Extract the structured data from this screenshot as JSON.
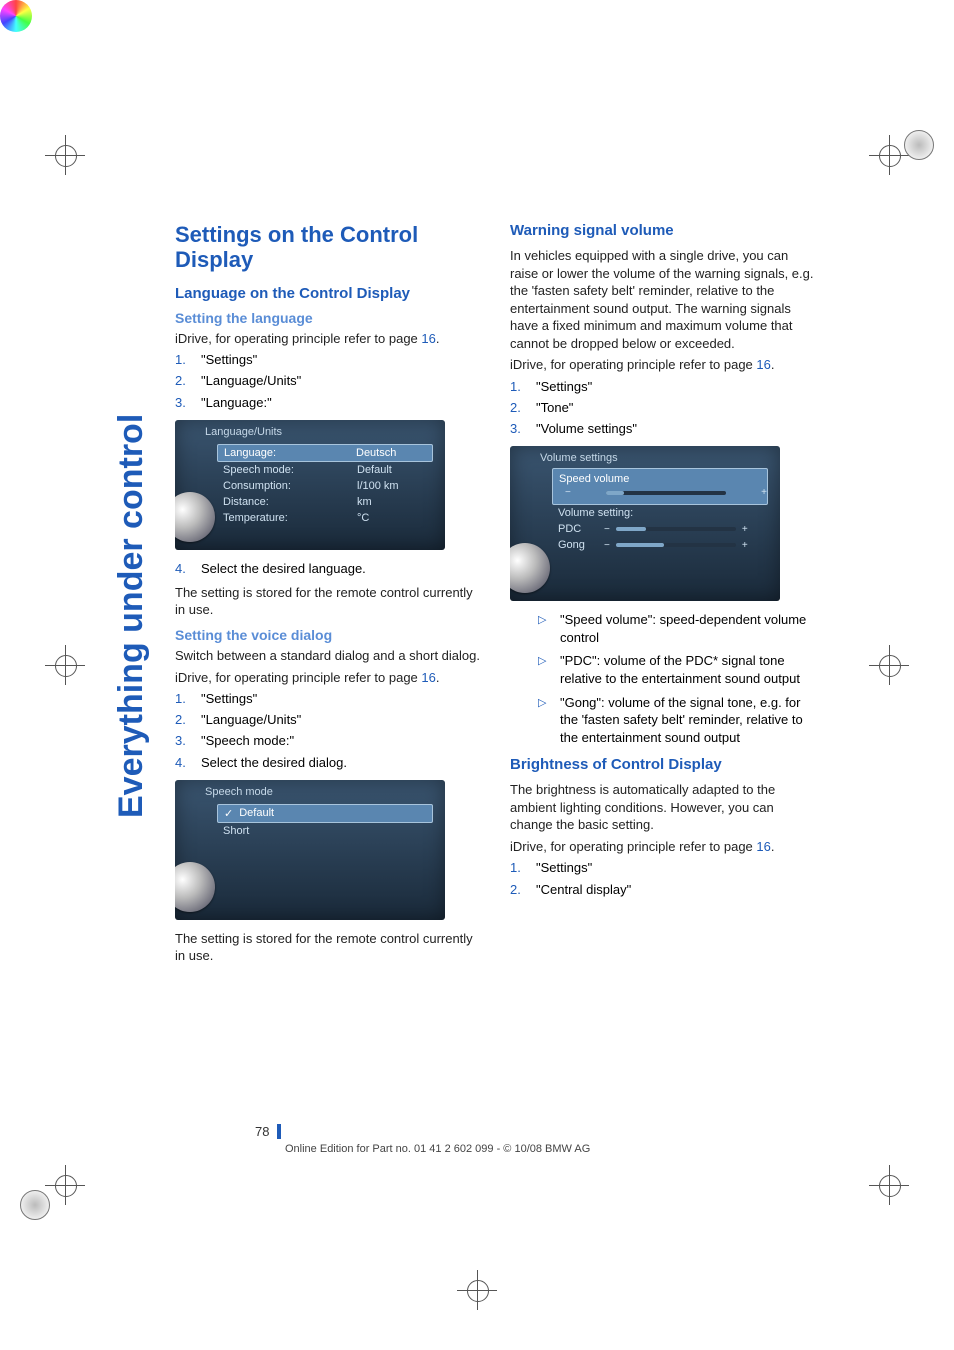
{
  "sidetab": "Everything under control",
  "page_number": "78",
  "footer_copy": "Online Edition for Part no. 01 41 2 602 099 - © 10/08 BMW AG",
  "page_ref": "16",
  "left": {
    "h1": "Settings on the Control Display",
    "h2a": "Language on the Control Display",
    "h3a": "Setting the language",
    "idrive_prefix": "iDrive, for operating principle refer to page ",
    "steps1": [
      "\"Settings\"",
      "\"Language/Units\"",
      "\"Language:\""
    ],
    "screenshot1": {
      "title": "Language/Units",
      "rows": [
        {
          "k": "Language:",
          "v": "Deutsch",
          "sel": true
        },
        {
          "k": "Speech mode:",
          "v": "Default"
        },
        {
          "k": "Consumption:",
          "v": "l/100 km"
        },
        {
          "k": "Distance:",
          "v": "km"
        },
        {
          "k": "Temperature:",
          "v": "°C"
        }
      ]
    },
    "step4": "Select the desired language.",
    "note1": "The setting is stored for the remote control currently in use.",
    "h3b": "Setting the voice dialog",
    "voice_intro": "Switch between a standard dialog and a short dialog.",
    "steps2": [
      "\"Settings\"",
      "\"Language/Units\"",
      "\"Speech mode:\"",
      "Select the desired dialog."
    ],
    "screenshot2": {
      "title": "Speech mode",
      "rows": [
        {
          "k": "Default",
          "sel": true,
          "check": true
        },
        {
          "k": "Short"
        }
      ]
    },
    "note2": "The setting is stored for the remote control currently in use."
  },
  "right": {
    "h2a": "Warning signal volume",
    "warn_body": "In vehicles equipped with a single drive, you can raise or lower the volume of the warning signals, e.g. the 'fasten safety belt' reminder, relative to the entertainment sound output. The warning signals have a fixed minimum and maximum volume that cannot be dropped below or exceeded.",
    "steps1": [
      "\"Settings\"",
      "\"Tone\"",
      "\"Volume settings\""
    ],
    "screenshot1": {
      "title": "Volume settings",
      "speed_label": "Speed volume",
      "section": "Volume setting:",
      "pdc": "PDC",
      "gong": "Gong"
    },
    "bullets": [
      "\"Speed volume\": speed-dependent volume control",
      "\"PDC\": volume of the PDC* signal tone relative to the entertainment sound output",
      "\"Gong\": volume of the signal tone, e.g. for the 'fasten safety belt' reminder, relative to the entertainment sound output"
    ],
    "h2b": "Brightness of Control Display",
    "bright_body": "The brightness is automatically adapted to the ambient lighting conditions. However, you can change the basic setting.",
    "steps2": [
      "\"Settings\"",
      "\"Central display\""
    ]
  }
}
